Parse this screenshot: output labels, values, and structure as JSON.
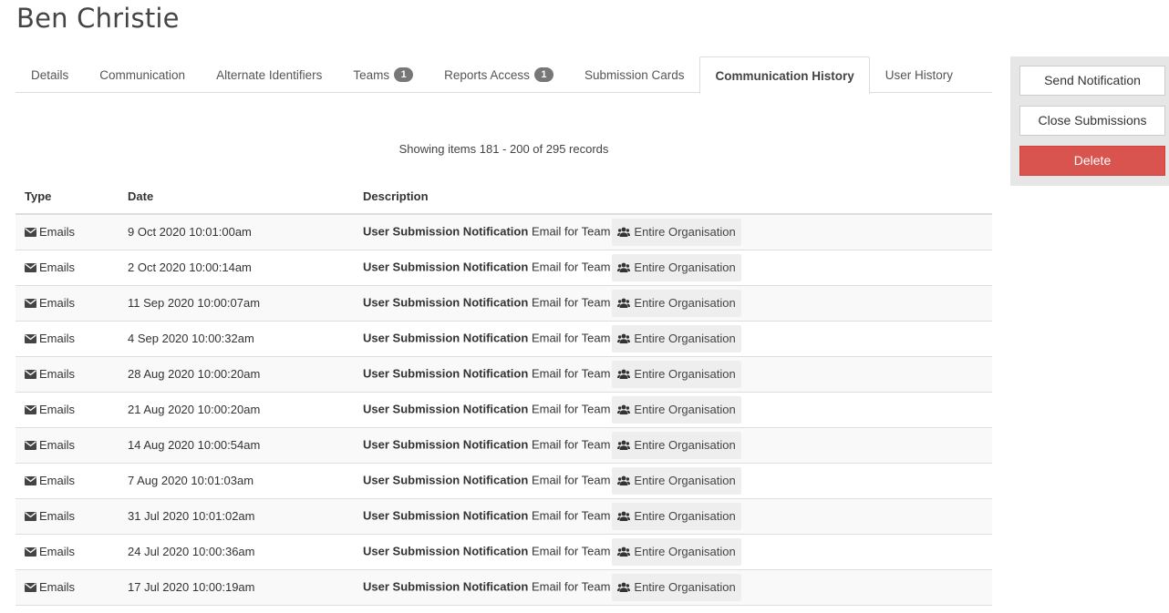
{
  "page": {
    "title": "Ben Christie"
  },
  "tabs": [
    {
      "label": "Details",
      "badge": null
    },
    {
      "label": "Communication",
      "badge": null
    },
    {
      "label": "Alternate Identifiers",
      "badge": null
    },
    {
      "label": "Teams",
      "badge": "1"
    },
    {
      "label": "Reports Access",
      "badge": "1"
    },
    {
      "label": "Submission Cards",
      "badge": null
    },
    {
      "label": "Communication History",
      "badge": null,
      "active": true
    },
    {
      "label": "User History",
      "badge": null
    }
  ],
  "pagination": {
    "showing_text": "Showing items 181 - 200 of 295 records"
  },
  "table": {
    "headers": {
      "type": "Type",
      "date": "Date",
      "description": "Description"
    },
    "rows": [
      {
        "type": "Emails",
        "date": "9 Oct 2020 10:01:00am",
        "desc_bold": "User Submission Notification",
        "desc_text": "Email for Team",
        "team": "Entire Organisation"
      },
      {
        "type": "Emails",
        "date": "2 Oct 2020 10:00:14am",
        "desc_bold": "User Submission Notification",
        "desc_text": "Email for Team",
        "team": "Entire Organisation"
      },
      {
        "type": "Emails",
        "date": "11 Sep 2020 10:00:07am",
        "desc_bold": "User Submission Notification",
        "desc_text": "Email for Team",
        "team": "Entire Organisation"
      },
      {
        "type": "Emails",
        "date": "4 Sep 2020 10:00:32am",
        "desc_bold": "User Submission Notification",
        "desc_text": "Email for Team",
        "team": "Entire Organisation"
      },
      {
        "type": "Emails",
        "date": "28 Aug 2020 10:00:20am",
        "desc_bold": "User Submission Notification",
        "desc_text": "Email for Team",
        "team": "Entire Organisation"
      },
      {
        "type": "Emails",
        "date": "21 Aug 2020 10:00:20am",
        "desc_bold": "User Submission Notification",
        "desc_text": "Email for Team",
        "team": "Entire Organisation"
      },
      {
        "type": "Emails",
        "date": "14 Aug 2020 10:00:54am",
        "desc_bold": "User Submission Notification",
        "desc_text": "Email for Team",
        "team": "Entire Organisation"
      },
      {
        "type": "Emails",
        "date": "7 Aug 2020 10:01:03am",
        "desc_bold": "User Submission Notification",
        "desc_text": "Email for Team",
        "team": "Entire Organisation"
      },
      {
        "type": "Emails",
        "date": "31 Jul 2020 10:01:02am",
        "desc_bold": "User Submission Notification",
        "desc_text": "Email for Team",
        "team": "Entire Organisation"
      },
      {
        "type": "Emails",
        "date": "24 Jul 2020 10:00:36am",
        "desc_bold": "User Submission Notification",
        "desc_text": "Email for Team",
        "team": "Entire Organisation"
      },
      {
        "type": "Emails",
        "date": "17 Jul 2020 10:00:19am",
        "desc_bold": "User Submission Notification",
        "desc_text": "Email for Team",
        "team": "Entire Organisation"
      }
    ]
  },
  "actions": {
    "send_notification": "Send Notification",
    "close_submissions": "Close Submissions",
    "delete": "Delete"
  },
  "icons": {
    "type_icon": "envelope-icon",
    "team_icon": "users-icon"
  },
  "colors": {
    "danger": "#d9534f",
    "badge": "#777777",
    "panel": "#e6e6e6"
  }
}
